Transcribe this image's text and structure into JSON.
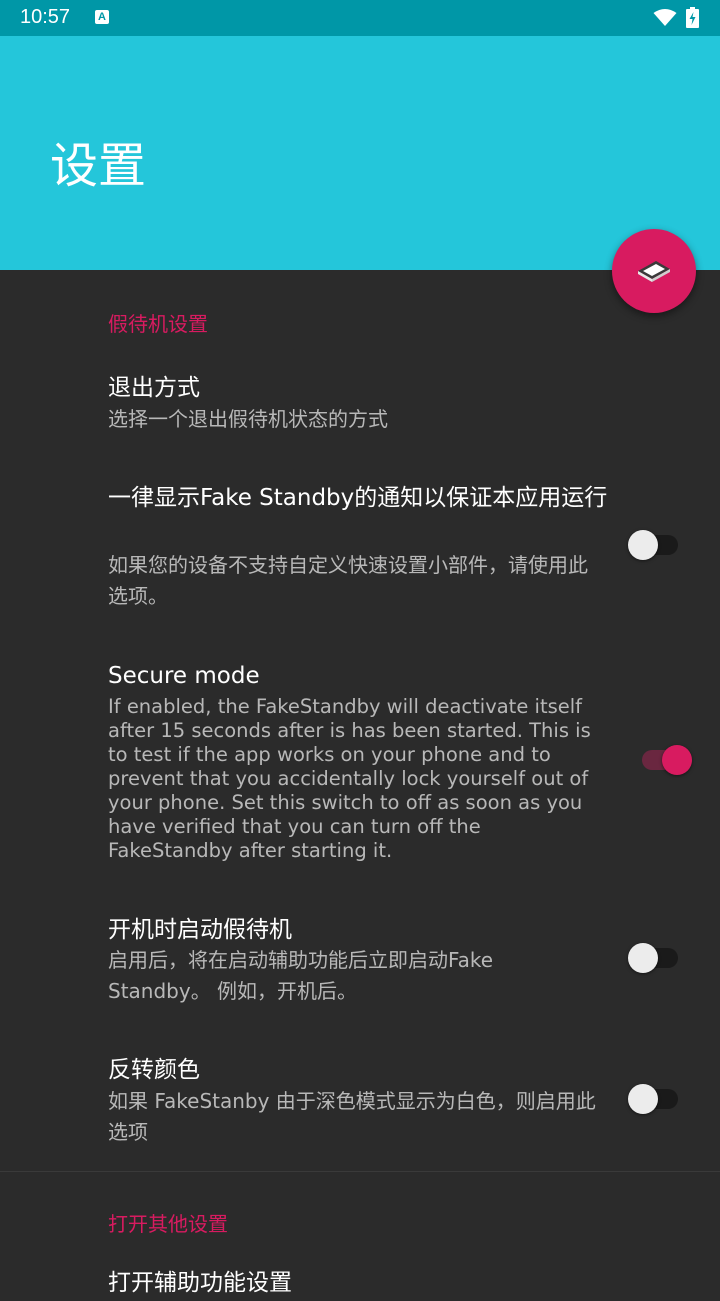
{
  "status_bar": {
    "time": "10:57",
    "notification_icon": "a-notification-icon",
    "wifi_icon": "wifi-icon",
    "battery_icon": "battery-charging-icon"
  },
  "app_bar": {
    "title": "设置",
    "color": "#24c6da"
  },
  "fab": {
    "icon": "standby-device-icon",
    "color": "#d81b60"
  },
  "sections": [
    {
      "header": "假待机设置",
      "items": [
        {
          "title": "退出方式",
          "summary": "选择一个退出假待机状态的方式"
        },
        {
          "title": "一律显示Fake Standby的通知以保证本应用运行",
          "summary": "如果您的设备不支持自定义快速设置小部件，请使用此选项。",
          "switch": false
        },
        {
          "title": "Secure mode",
          "summary": "If enabled, the FakeStandby will deactivate itself after 15 seconds after is has been started. This is to test if the app works on your phone and to prevent that you accidentally lock yourself out of your phone. Set this switch to off as soon as you have verified that you can turn off the FakeStandby after starting it.",
          "switch": true
        },
        {
          "title": "开机时启动假待机",
          "summary": "启用后，将在启动辅助功能后立即启动Fake Standby。 例如，开机后。",
          "switch": false
        },
        {
          "title": "反转颜色",
          "summary": "如果 FakeStanby 由于深色模式显示为白色，则启用此选项",
          "switch": false
        }
      ]
    },
    {
      "header": "打开其他设置",
      "items": [
        {
          "title": "打开辅助功能设置"
        }
      ]
    }
  ],
  "accent_color": "#d81b60"
}
